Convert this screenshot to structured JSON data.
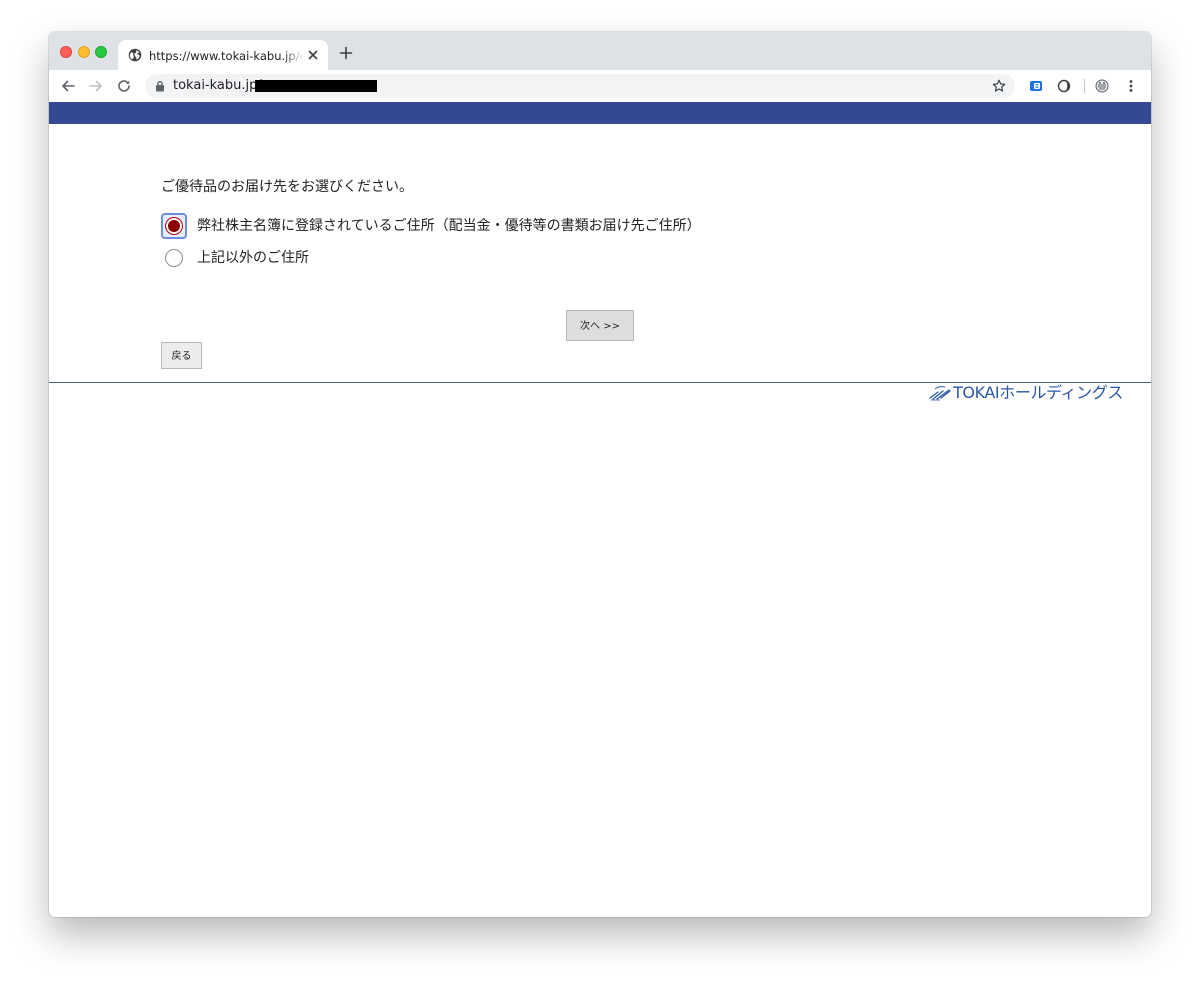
{
  "browser": {
    "tab_title": "https://www.tokai-kabu.jp/orca",
    "url_visible": "tokai-kabu.jp/",
    "new_tab_label": "+"
  },
  "page": {
    "prompt": "ご優待品のお届け先をお選びください。",
    "options": [
      {
        "label": "弊社株主名簿に登録されているご住所（配当金・優待等の書類お届け先ご住所）",
        "checked": true
      },
      {
        "label": "上記以外のご住所",
        "checked": false
      }
    ],
    "next_button": "次へ >>",
    "back_button": "戻る",
    "logo_text": "TOKAIホールディングス"
  },
  "colors": {
    "header_bar": "#344893",
    "logo_blue": "#2a56a8",
    "radio_selected": "#8c0000"
  },
  "icons": {
    "tab_favicon": "globe-icon",
    "tab_close": "close-icon",
    "back": "arrow-left-icon",
    "forward": "arrow-right-icon",
    "reload": "reload-icon",
    "lock": "lock-icon",
    "bookmark": "star-icon",
    "extensions": [
      "extension-icon-1",
      "extension-icon-2",
      "extension-icon-3"
    ],
    "menu": "kebab-menu-icon"
  }
}
